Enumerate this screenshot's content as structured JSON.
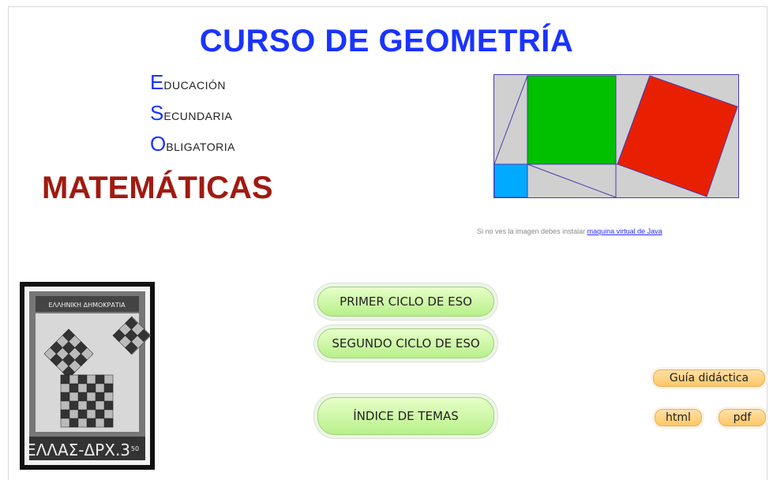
{
  "header": {
    "title": "CURSO DE GEOMETRÍA",
    "eso": [
      {
        "initial": "E",
        "rest": "ducación"
      },
      {
        "initial": "S",
        "rest": "ecundaria"
      },
      {
        "initial": "O",
        "rest": "bligatoria"
      }
    ],
    "subject": "MATEMÁTICAS"
  },
  "applet": {
    "note_text": "Si no ves la imagen debes instalar ",
    "note_link": "maquina virtual de Java",
    "colors": {
      "green": "#00c000",
      "red": "#e82000",
      "blue": "#00aaff",
      "gray": "#d0d0d0",
      "line": "#4a3ab0"
    }
  },
  "stamp": {
    "top_text": "ΕΛΛΗΝΙΚΗ ΔΗΜΟΚΡΑΤΙΑ",
    "bottom_text": "ΕΛΛΑΣ-ΔΡΧ.3",
    "value_small": "50"
  },
  "buttons": {
    "primer": "PRIMER CICLO DE ESO",
    "segundo": "SEGUNDO  CICLO DE ESO",
    "indice": "ÍNDICE DE TEMAS",
    "guia": "Guía didáctica",
    "html": "html",
    "pdf": "pdf"
  }
}
